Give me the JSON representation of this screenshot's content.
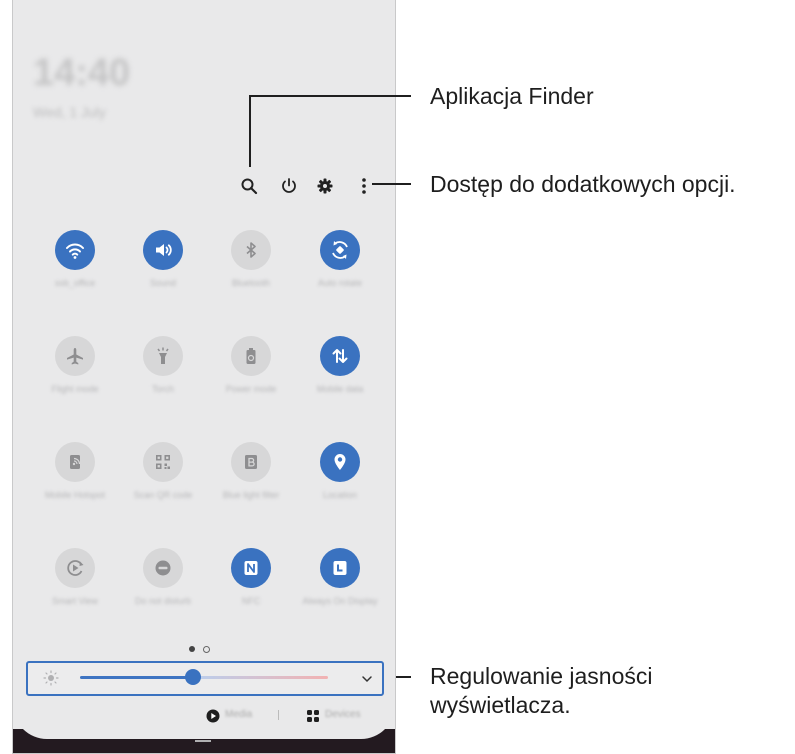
{
  "lockscreen": {
    "time": "14:40",
    "date": "Wed, 1 July"
  },
  "tiles": [
    {
      "label": "ssb_office",
      "icon": "wifi-icon",
      "state": "on"
    },
    {
      "label": "Sound",
      "icon": "sound-icon",
      "state": "on"
    },
    {
      "label": "Bluetooth",
      "icon": "bluetooth-icon",
      "state": "off"
    },
    {
      "label": "Auto rotate",
      "icon": "auto-rotate-icon",
      "state": "on"
    },
    {
      "label": "Flight mode",
      "icon": "airplane-icon",
      "state": "off"
    },
    {
      "label": "Torch",
      "icon": "torch-icon",
      "state": "off"
    },
    {
      "label": "Power mode",
      "icon": "power-mode-icon",
      "state": "off"
    },
    {
      "label": "Mobile data",
      "icon": "mobile-data-icon",
      "state": "on"
    },
    {
      "label": "Mobile Hotspot",
      "icon": "hotspot-icon",
      "state": "off"
    },
    {
      "label": "Scan QR code",
      "icon": "qr-code-icon",
      "state": "off"
    },
    {
      "label": "Blue light filter",
      "icon": "blue-light-icon",
      "state": "off"
    },
    {
      "label": "Location",
      "icon": "location-icon",
      "state": "on"
    },
    {
      "label": "Smart View",
      "icon": "smart-view-icon",
      "state": "off"
    },
    {
      "label": "Do not disturb",
      "icon": "dnd-icon",
      "state": "off"
    },
    {
      "label": "NFC",
      "icon": "nfc-icon",
      "state": "on"
    },
    {
      "label": "Always On Display",
      "icon": "aod-icon",
      "state": "on"
    }
  ],
  "brightness": {
    "level": 0.45
  },
  "bottom": {
    "media_label": "Media",
    "devices_label": "Devices"
  },
  "callouts": {
    "finder": "Aplikacja Finder",
    "more_options": "Dostęp do dodatkowych opcji.",
    "brightness_line1": "Regulowanie jasności",
    "brightness_line2": "wyświetlacza."
  },
  "colors": {
    "accent": "#3a72c0",
    "tile_off": "#d7d7d8",
    "panel": "#e9e9ea"
  }
}
